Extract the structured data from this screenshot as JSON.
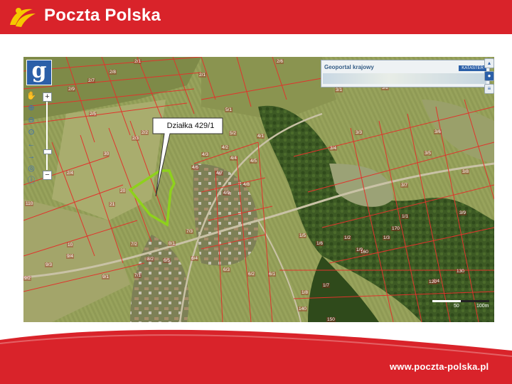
{
  "header": {
    "brand": "Poczta Polska",
    "color": "#d9232a"
  },
  "footer": {
    "url": "www.poczta-polska.pl"
  },
  "map": {
    "banner_title": "Geoportal krajowy",
    "banner_label": "KATASTER",
    "callout": "Działka 429/1",
    "scale_left": "50",
    "scale_right": "100m",
    "highlight_color": "#8ed11c",
    "parcel_labels": [
      "2/1",
      "2/6",
      "2/7",
      "2/9",
      "2/8",
      "2/1",
      "2/2",
      "2/3",
      "30",
      "2/5",
      "2/4",
      "5/1",
      "5/2",
      "4/1",
      "4/2",
      "4/3",
      "4/4",
      "4/5",
      "4/6",
      "4/7",
      "4/8",
      "4/9",
      "20",
      "21",
      "10",
      "3/1",
      "3/2",
      "3/3",
      "3/4",
      "3/5",
      "3/6",
      "3/7",
      "3/8",
      "3/9",
      "1/1",
      "1/2",
      "1/3",
      "1/4",
      "1/5",
      "1/6",
      "1/7",
      "1/8",
      "1/9",
      "6/1",
      "6/2",
      "6/3",
      "6/4",
      "6/5",
      "7/1",
      "7/2",
      "7/3",
      "8/1",
      "8/2",
      "9/1",
      "9/2",
      "9/3",
      "9/4",
      "110",
      "120",
      "130",
      "140",
      "150",
      "160",
      "170"
    ]
  }
}
